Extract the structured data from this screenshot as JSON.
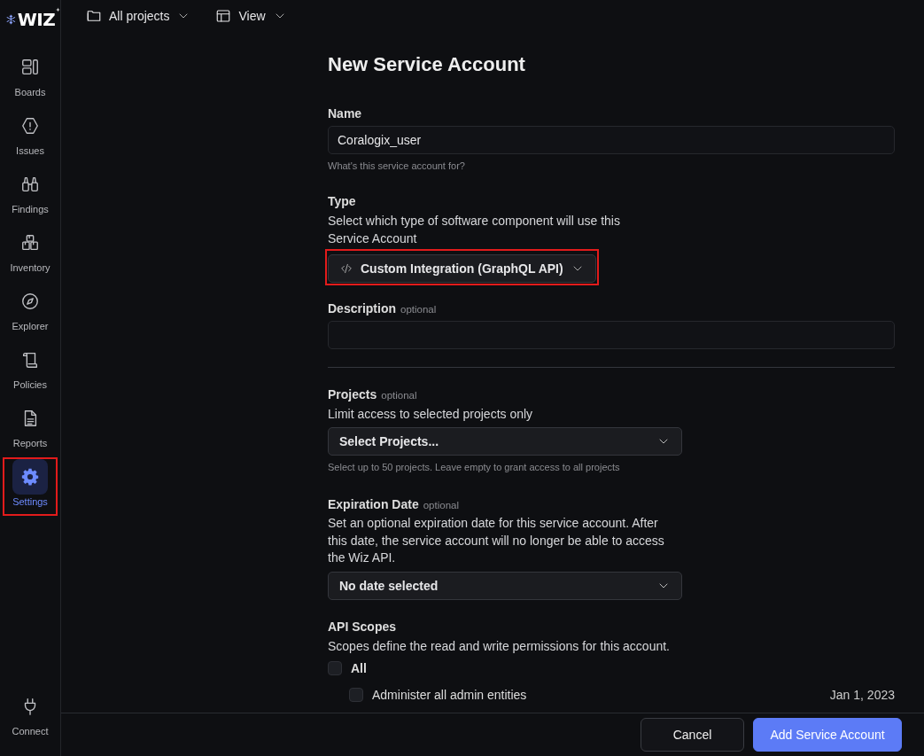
{
  "sidebar": {
    "logo": "WIZ",
    "items": [
      {
        "label": "Boards",
        "selected": false,
        "highlighted": false
      },
      {
        "label": "Issues",
        "selected": false,
        "highlighted": false
      },
      {
        "label": "Findings",
        "selected": false,
        "highlighted": false
      },
      {
        "label": "Inventory",
        "selected": false,
        "highlighted": false
      },
      {
        "label": "Explorer",
        "selected": false,
        "highlighted": false
      },
      {
        "label": "Policies",
        "selected": false,
        "highlighted": false
      },
      {
        "label": "Reports",
        "selected": false,
        "highlighted": false
      },
      {
        "label": "Settings",
        "selected": true,
        "highlighted": true
      }
    ],
    "bottom_item": {
      "label": "Connect"
    }
  },
  "topbar": {
    "items": [
      {
        "label": "All projects"
      },
      {
        "label": "View"
      }
    ]
  },
  "form": {
    "title": "New Service Account",
    "name": {
      "label": "Name",
      "value": "Coralogix_user",
      "hint": "What's this service account for?"
    },
    "type": {
      "label": "Type",
      "description": "Select which type of software component will use this Service Account",
      "value": "Custom Integration (GraphQL API)",
      "highlighted": true
    },
    "description": {
      "label": "Description",
      "optional": "optional"
    },
    "projects": {
      "label": "Projects",
      "optional": "optional",
      "description": "Limit access to selected projects only",
      "value": "Select Projects...",
      "hint": "Select up to 50 projects. Leave empty to grant access to all projects"
    },
    "expiration": {
      "label": "Expiration Date",
      "optional": "optional",
      "description": "Set an optional expiration date for this service account. After this date, the service account will no longer be able to access the Wiz API.",
      "value": "No date selected"
    },
    "api_scopes": {
      "label": "API Scopes",
      "description": "Scopes define the read and write permissions for this account.",
      "options": [
        {
          "label": "All",
          "checked": false,
          "kind": "group"
        },
        {
          "label": "Administer all admin entities",
          "checked": false,
          "kind": "item",
          "date": "Jan 1, 2023"
        }
      ]
    }
  },
  "footer": {
    "buttons": [
      {
        "label": "Cancel",
        "kind": "secondary"
      },
      {
        "label": "Add Service Account",
        "kind": "primary"
      }
    ]
  }
}
